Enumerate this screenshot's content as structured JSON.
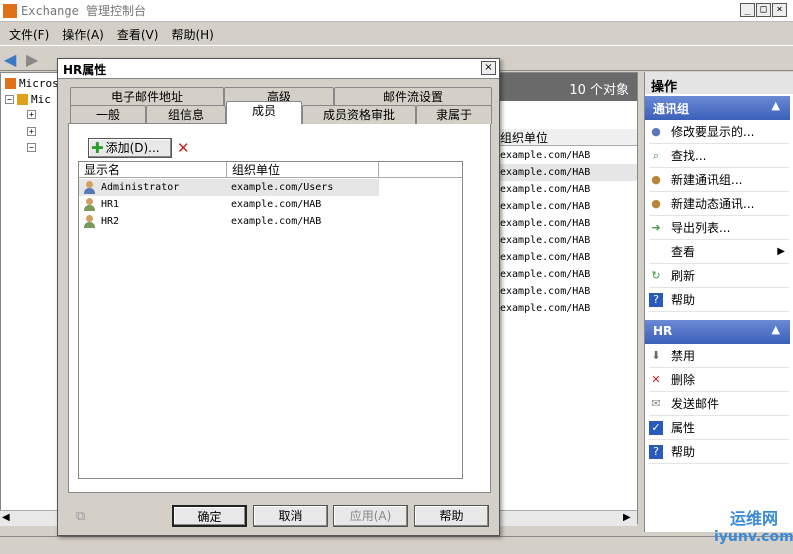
{
  "app": {
    "title": "Exchange 管理控制台"
  },
  "menu": [
    "文件(F)",
    "操作(A)",
    "查看(V)",
    "帮助(H)"
  ],
  "tree": {
    "items": [
      "Micros",
      "Mic"
    ]
  },
  "list": {
    "count_label": "10 个对象",
    "column": "组织单位",
    "rows": [
      "example.com/HAB",
      "example.com/HAB",
      "example.com/HAB",
      "example.com/HAB",
      "example.com/HAB",
      "example.com/HAB",
      "example.com/HAB",
      "example.com/HAB",
      "example.com/HAB",
      "example.com/HAB"
    ]
  },
  "actions": {
    "title": "操作",
    "section1": {
      "title": "通讯组",
      "items": [
        "修改要显示的...",
        "查找...",
        "新建通讯组...",
        "新建动态通讯...",
        "导出列表...",
        "查看",
        "刷新",
        "帮助"
      ]
    },
    "section2": {
      "title": "HR",
      "items": [
        "禁用",
        "删除",
        "发送邮件",
        "属性",
        "帮助"
      ]
    }
  },
  "dialog": {
    "title": "HR属性",
    "tabs_row1": [
      "电子邮件地址",
      "高级",
      "邮件流设置"
    ],
    "tabs_row2": [
      "一般",
      "组信息",
      "成员",
      "成员资格审批",
      "隶属于"
    ],
    "add_button": "添加(D)...",
    "grid": {
      "columns": [
        "显示名",
        "组织单位"
      ],
      "rows": [
        {
          "name": "Administrator",
          "ou": "example.com/Users"
        },
        {
          "name": "HR1",
          "ou": "example.com/HAB"
        },
        {
          "name": "HR2",
          "ou": "example.com/HAB"
        }
      ]
    },
    "buttons": {
      "ok": "确定",
      "cancel": "取消",
      "apply": "应用(A)",
      "help": "帮助"
    }
  },
  "watermark": {
    "cn": "运维网",
    "en": "iyunv.com"
  }
}
